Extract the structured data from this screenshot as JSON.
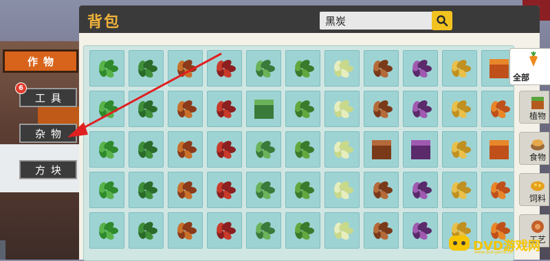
{
  "window": {
    "title": "背包"
  },
  "search": {
    "value": "黑炭"
  },
  "left_categories": [
    {
      "label": "作物",
      "active": true
    },
    {
      "label": "工具",
      "active": false,
      "badge": "6"
    },
    {
      "label": "杂物",
      "active": false
    },
    {
      "label": "方块",
      "active": false
    }
  ],
  "right_filters": [
    {
      "label": "全部",
      "active": true,
      "icon": "carrot-icon"
    },
    {
      "label": "植物",
      "icon": "plant-block-icon"
    },
    {
      "label": "食物",
      "icon": "bread-basket-icon"
    },
    {
      "label": "饲料",
      "icon": "feed-icon"
    },
    {
      "label": "工艺",
      "icon": "craft-icon"
    }
  ],
  "grid_items": [
    "green-bush-icon",
    "dark-grass-icon",
    "autumn-bush-icon",
    "red-bush-icon",
    "leafy-bush-icon",
    "green-shrub-icon",
    "tall-grass-icon",
    "brown-leaf-icon",
    "purple-plant-icon",
    "wheat-icon",
    "pumpkin-block-icon",
    "vine-icon",
    "reed-grass-icon",
    "carrot-icon",
    "flower-sprouts-icon",
    "melon-block-icon",
    "potato-icon",
    "cactus-icon",
    "wheat-stalk-icon",
    "green-stalk-icon",
    "seaweed-icon",
    "lily-pad-cluster-icon",
    "lily-pad-icon",
    "pink-lily-icon",
    "bamboo-icon",
    "fern-icon",
    "conifer-sprout-icon",
    "pink-berry-bush-icon",
    "purple-bush-icon",
    "mushroom-block-icon",
    "red-mushroom-block-icon",
    "rainbow-flower-icon",
    "stone-block-icon",
    "sunflower-icon",
    "pink-flower-stem-icon",
    "blue-flower-icon",
    "red-lily-icon",
    "blue-flower-cluster-icon",
    "palm-sprout-icon",
    "banana-plant-icon",
    "pink-flower-icon",
    "red-flower-icon",
    "white-lily-icon",
    "pink-lily-star-icon",
    "white-flower-bush-icon",
    "yellow-flower-icon",
    "red-rose-bush-icon",
    "magenta-grass-icon",
    "pink-petals-icon",
    "white-petals-icon",
    "green-seeds-icon",
    "berry-bush-icon",
    "dark-fern-icon",
    "green-bush-small-icon",
    "purple-berries-icon"
  ],
  "watermark": {
    "text": "DVD游戏网",
    "sub": "www.dvd-game.cn"
  },
  "colors": {
    "accent": "#d8641b",
    "title": "#f0b23a",
    "search_button": "#f2c21f",
    "cell": "#9ed3d4",
    "arrow": "#e02020"
  }
}
